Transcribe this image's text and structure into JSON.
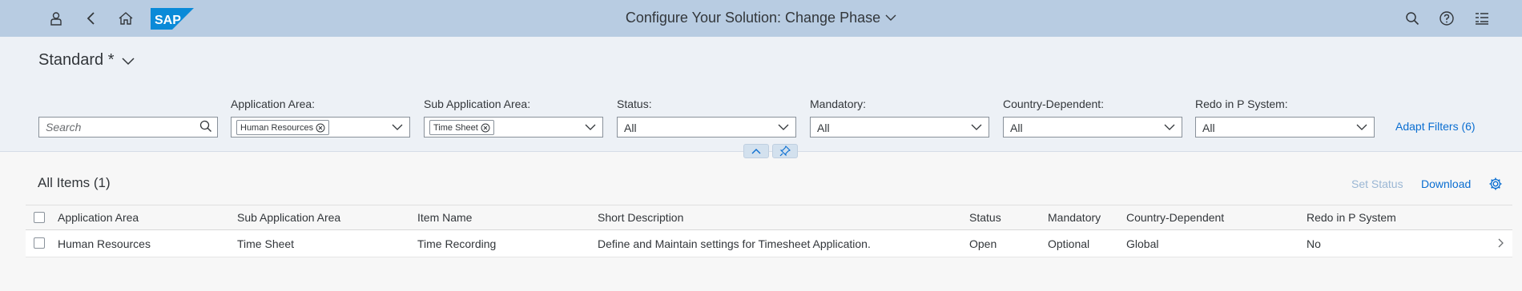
{
  "shell": {
    "title": "Configure Your Solution: Change Phase",
    "logo_text": "SAP",
    "icons": [
      "user-icon",
      "back-icon",
      "home-icon",
      "search-icon",
      "help-icon",
      "notifications-icon"
    ]
  },
  "filterbar": {
    "variant": "Standard *",
    "search_placeholder": "Search",
    "filters": [
      {
        "label": "Application Area:",
        "token": "Human Resources",
        "value": ""
      },
      {
        "label": "Sub Application Area:",
        "token": "Time Sheet",
        "value": ""
      },
      {
        "label": "Status:",
        "token": "",
        "value": "All"
      },
      {
        "label": "Mandatory:",
        "token": "",
        "value": "All"
      },
      {
        "label": "Country-Dependent:",
        "token": "",
        "value": "All"
      },
      {
        "label": "Redo in P System:",
        "token": "",
        "value": "All"
      }
    ],
    "adapt_filters": "Adapt Filters (6)"
  },
  "table": {
    "title": "All Items (1)",
    "set_status": "Set Status",
    "download": "Download",
    "columns": [
      "Application Area",
      "Sub Application Area",
      "Item Name",
      "Short Description",
      "Status",
      "Mandatory",
      "Country-Dependent",
      "Redo in P System"
    ],
    "rows": [
      [
        "Human Resources",
        "Time Sheet",
        "Time Recording",
        "Define and Maintain settings for Timesheet Application.",
        "Open",
        "Optional",
        "Global",
        "No"
      ]
    ]
  },
  "colors": {
    "shell": "#b8cce2",
    "filterbar": "#edf1f6",
    "link": "#0a6ed1",
    "sap_blue": "#0a8ad8"
  }
}
